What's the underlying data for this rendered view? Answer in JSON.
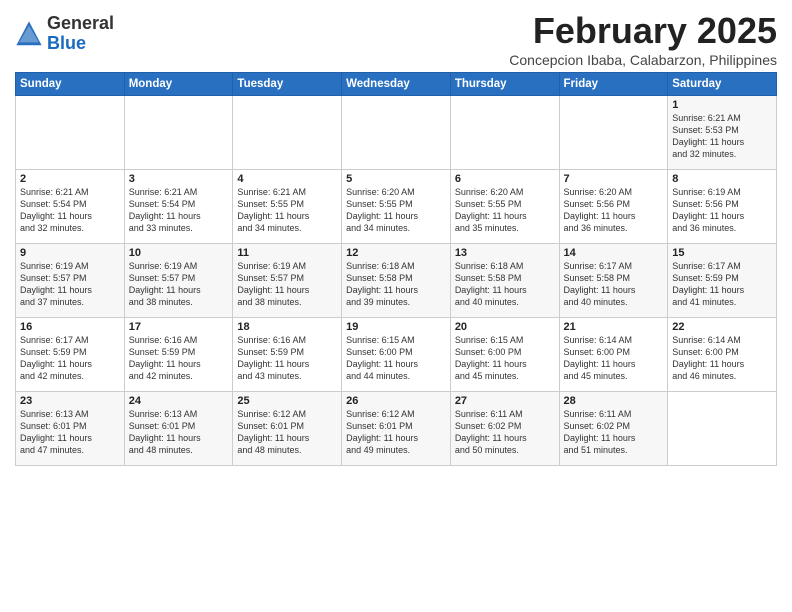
{
  "header": {
    "logo_general": "General",
    "logo_blue": "Blue",
    "title": "February 2025",
    "subtitle": "Concepcion Ibaba, Calabarzon, Philippines"
  },
  "days_of_week": [
    "Sunday",
    "Monday",
    "Tuesday",
    "Wednesday",
    "Thursday",
    "Friday",
    "Saturday"
  ],
  "weeks": [
    [
      {
        "day": "",
        "info": ""
      },
      {
        "day": "",
        "info": ""
      },
      {
        "day": "",
        "info": ""
      },
      {
        "day": "",
        "info": ""
      },
      {
        "day": "",
        "info": ""
      },
      {
        "day": "",
        "info": ""
      },
      {
        "day": "1",
        "info": "Sunrise: 6:21 AM\nSunset: 5:53 PM\nDaylight: 11 hours\nand 32 minutes."
      }
    ],
    [
      {
        "day": "2",
        "info": "Sunrise: 6:21 AM\nSunset: 5:54 PM\nDaylight: 11 hours\nand 32 minutes."
      },
      {
        "day": "3",
        "info": "Sunrise: 6:21 AM\nSunset: 5:54 PM\nDaylight: 11 hours\nand 33 minutes."
      },
      {
        "day": "4",
        "info": "Sunrise: 6:21 AM\nSunset: 5:55 PM\nDaylight: 11 hours\nand 34 minutes."
      },
      {
        "day": "5",
        "info": "Sunrise: 6:20 AM\nSunset: 5:55 PM\nDaylight: 11 hours\nand 34 minutes."
      },
      {
        "day": "6",
        "info": "Sunrise: 6:20 AM\nSunset: 5:55 PM\nDaylight: 11 hours\nand 35 minutes."
      },
      {
        "day": "7",
        "info": "Sunrise: 6:20 AM\nSunset: 5:56 PM\nDaylight: 11 hours\nand 36 minutes."
      },
      {
        "day": "8",
        "info": "Sunrise: 6:19 AM\nSunset: 5:56 PM\nDaylight: 11 hours\nand 36 minutes."
      }
    ],
    [
      {
        "day": "9",
        "info": "Sunrise: 6:19 AM\nSunset: 5:57 PM\nDaylight: 11 hours\nand 37 minutes."
      },
      {
        "day": "10",
        "info": "Sunrise: 6:19 AM\nSunset: 5:57 PM\nDaylight: 11 hours\nand 38 minutes."
      },
      {
        "day": "11",
        "info": "Sunrise: 6:19 AM\nSunset: 5:57 PM\nDaylight: 11 hours\nand 38 minutes."
      },
      {
        "day": "12",
        "info": "Sunrise: 6:18 AM\nSunset: 5:58 PM\nDaylight: 11 hours\nand 39 minutes."
      },
      {
        "day": "13",
        "info": "Sunrise: 6:18 AM\nSunset: 5:58 PM\nDaylight: 11 hours\nand 40 minutes."
      },
      {
        "day": "14",
        "info": "Sunrise: 6:17 AM\nSunset: 5:58 PM\nDaylight: 11 hours\nand 40 minutes."
      },
      {
        "day": "15",
        "info": "Sunrise: 6:17 AM\nSunset: 5:59 PM\nDaylight: 11 hours\nand 41 minutes."
      }
    ],
    [
      {
        "day": "16",
        "info": "Sunrise: 6:17 AM\nSunset: 5:59 PM\nDaylight: 11 hours\nand 42 minutes."
      },
      {
        "day": "17",
        "info": "Sunrise: 6:16 AM\nSunset: 5:59 PM\nDaylight: 11 hours\nand 42 minutes."
      },
      {
        "day": "18",
        "info": "Sunrise: 6:16 AM\nSunset: 5:59 PM\nDaylight: 11 hours\nand 43 minutes."
      },
      {
        "day": "19",
        "info": "Sunrise: 6:15 AM\nSunset: 6:00 PM\nDaylight: 11 hours\nand 44 minutes."
      },
      {
        "day": "20",
        "info": "Sunrise: 6:15 AM\nSunset: 6:00 PM\nDaylight: 11 hours\nand 45 minutes."
      },
      {
        "day": "21",
        "info": "Sunrise: 6:14 AM\nSunset: 6:00 PM\nDaylight: 11 hours\nand 45 minutes."
      },
      {
        "day": "22",
        "info": "Sunrise: 6:14 AM\nSunset: 6:00 PM\nDaylight: 11 hours\nand 46 minutes."
      }
    ],
    [
      {
        "day": "23",
        "info": "Sunrise: 6:13 AM\nSunset: 6:01 PM\nDaylight: 11 hours\nand 47 minutes."
      },
      {
        "day": "24",
        "info": "Sunrise: 6:13 AM\nSunset: 6:01 PM\nDaylight: 11 hours\nand 48 minutes."
      },
      {
        "day": "25",
        "info": "Sunrise: 6:12 AM\nSunset: 6:01 PM\nDaylight: 11 hours\nand 48 minutes."
      },
      {
        "day": "26",
        "info": "Sunrise: 6:12 AM\nSunset: 6:01 PM\nDaylight: 11 hours\nand 49 minutes."
      },
      {
        "day": "27",
        "info": "Sunrise: 6:11 AM\nSunset: 6:02 PM\nDaylight: 11 hours\nand 50 minutes."
      },
      {
        "day": "28",
        "info": "Sunrise: 6:11 AM\nSunset: 6:02 PM\nDaylight: 11 hours\nand 51 minutes."
      },
      {
        "day": "",
        "info": ""
      }
    ]
  ]
}
